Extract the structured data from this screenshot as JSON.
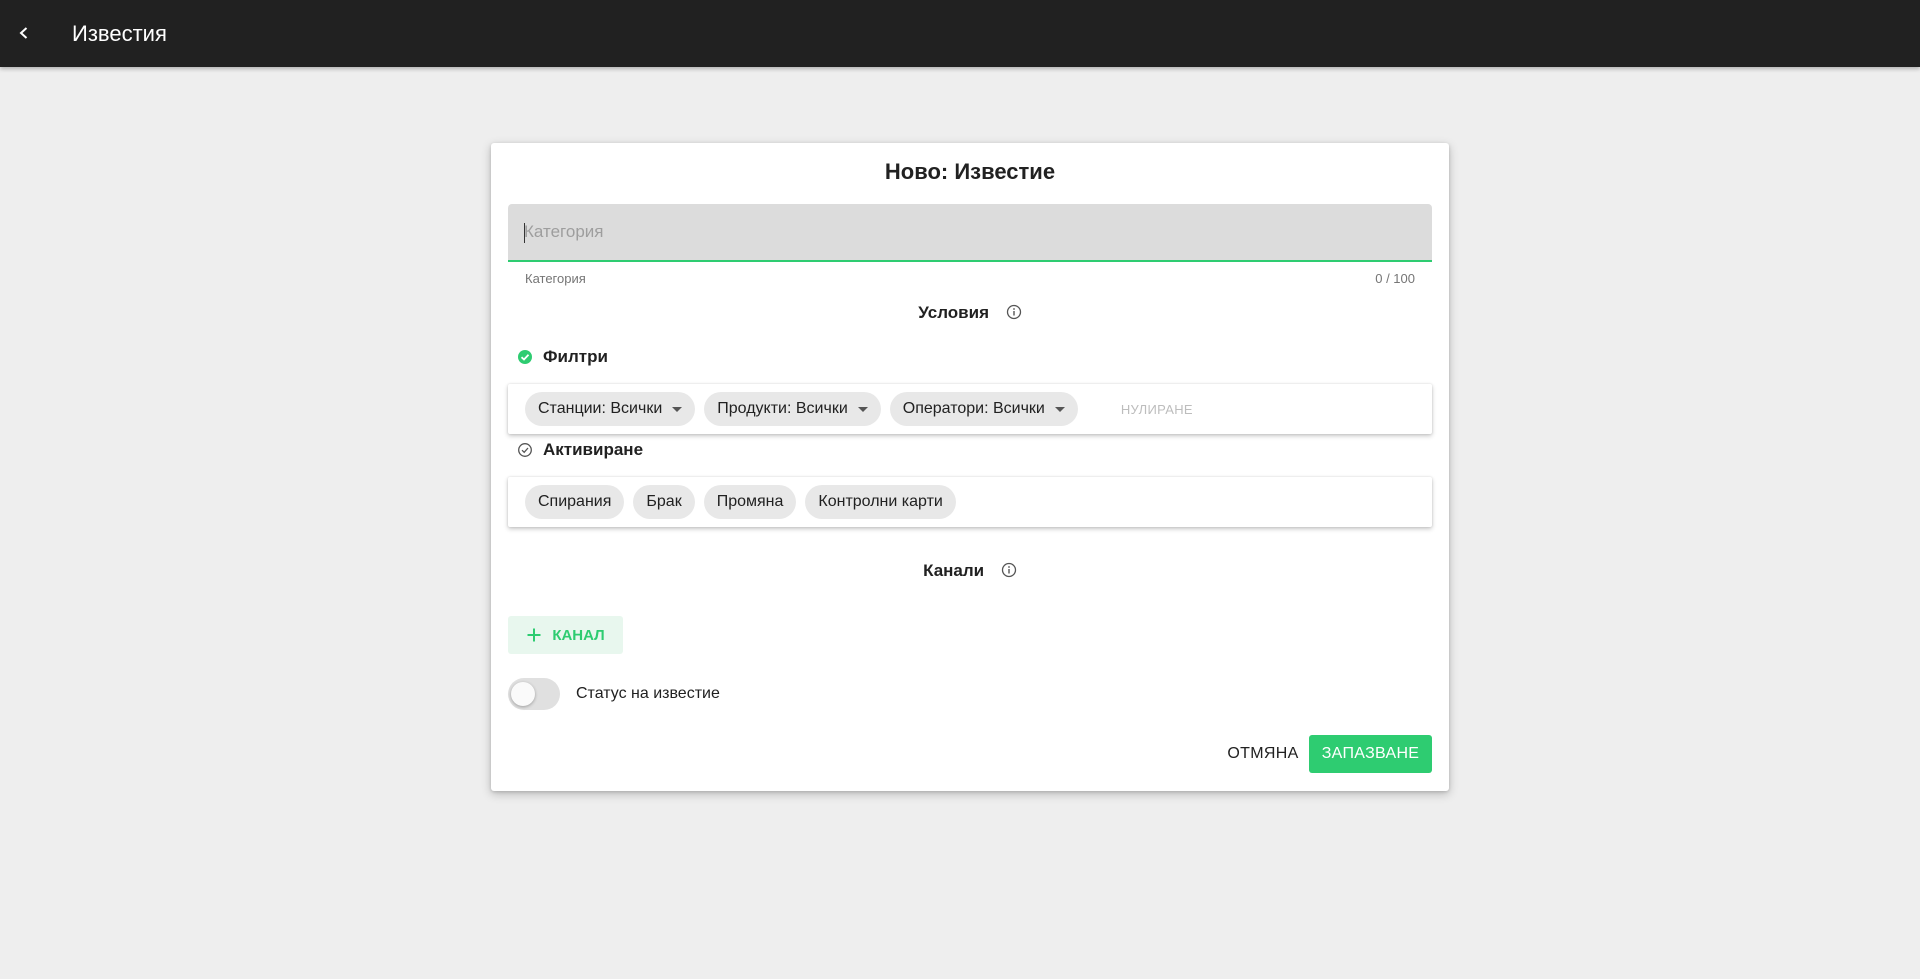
{
  "colors": {
    "accent": "#2ecc71",
    "topbar_bg": "#212121",
    "page_bg": "#eeeeee"
  },
  "topbar": {
    "back_icon": "chevron-left-icon",
    "title": "Известия"
  },
  "dialog": {
    "title": "Ново: Известие",
    "category_field": {
      "placeholder": "Категория",
      "value": "",
      "hint": "Категория",
      "counter": "0 / 100"
    },
    "conditions": {
      "title": "Условия",
      "info_icon": "info-icon",
      "filters": {
        "title": "Филтри",
        "status_icon": "check-circle-filled-icon",
        "chips": [
          {
            "label": "Станции: Всички"
          },
          {
            "label": "Продукти: Всички"
          },
          {
            "label": "Оператори: Всички"
          }
        ],
        "reset_label": "НУЛИРАНЕ"
      },
      "activation": {
        "title": "Активиране",
        "status_icon": "check-circle-outline-icon",
        "chips": [
          {
            "label": "Спирания"
          },
          {
            "label": "Брак"
          },
          {
            "label": "Промяна"
          },
          {
            "label": "Контролни карти"
          }
        ]
      }
    },
    "channels": {
      "title": "Канали",
      "info_icon": "info-icon",
      "add_label": "КАНАЛ",
      "add_icon": "plus-icon"
    },
    "status_toggle": {
      "label": "Статус на известие",
      "checked": false
    },
    "actions": {
      "cancel_label": "ОТМЯНА",
      "save_label": "ЗАПАЗВАНЕ"
    }
  }
}
